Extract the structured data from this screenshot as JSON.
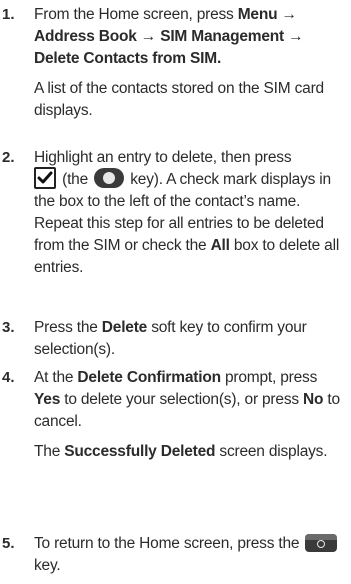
{
  "steps": [
    {
      "number": "1.",
      "p1": {
        "t1": "From the Home screen, press ",
        "b1": "Menu → Address Book → SIM Management → Delete Contacts from SIM."
      },
      "p2": "A list of the contacts stored on the SIM card displays."
    },
    {
      "number": "2.",
      "t1": "Highlight an entry to delete, then press",
      "t2": " (the ",
      "t3": " key). A check mark displays in the box to the left of the contact’s name. Repeat this step for all entries to be deleted from the SIM or check the ",
      "b1": "All",
      "t4": " box to delete all entries.",
      "icons": [
        "checkbox-checked-icon",
        "ok-key-icon"
      ]
    },
    {
      "number": "3.",
      "t1": "Press the ",
      "b1": "Delete",
      "t2": " soft key to confirm your selection(s)."
    },
    {
      "number": "4.",
      "p1": {
        "t1": "At the ",
        "b1": "Delete Confirmation",
        "t2": " prompt, press ",
        "b2": "Yes",
        "t3": " to delete your selection(s), or press ",
        "b3": "No",
        "t4": " to cancel."
      },
      "p2": {
        "t1": "The ",
        "b1": "Successfully Deleted",
        "t2": " screen displays."
      }
    },
    {
      "number": "5.",
      "t1": "To return to the Home screen, press the ",
      "t2": " key.",
      "icons": [
        "end-key-icon"
      ]
    }
  ]
}
